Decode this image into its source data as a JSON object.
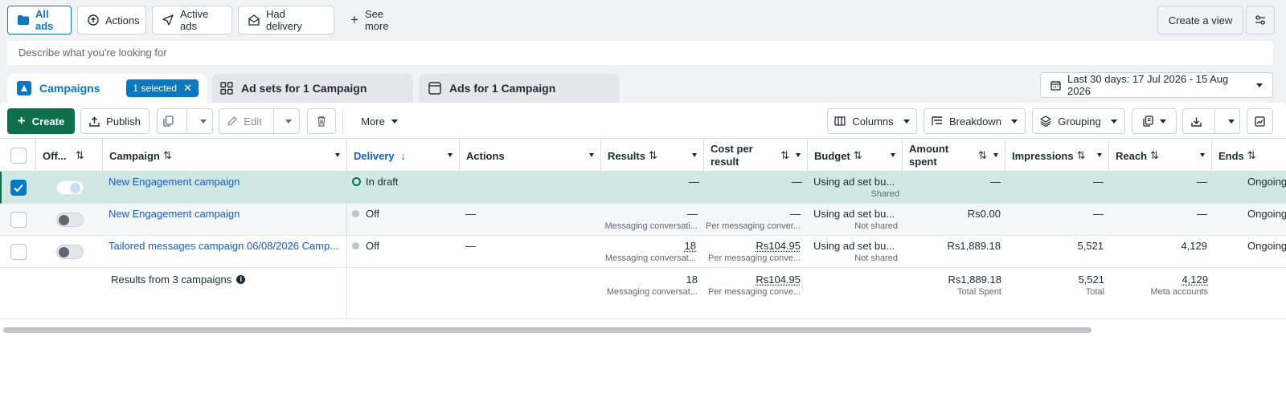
{
  "filters": {
    "all_ads": "All ads",
    "actions": "Actions",
    "active_ads": "Active ads",
    "had_delivery": "Had delivery",
    "see_more": "See more",
    "create_view": "Create a view"
  },
  "search": {
    "placeholder": "Describe what you're looking for"
  },
  "tabs": {
    "campaigns": "Campaigns",
    "selected": "1 selected",
    "ad_sets": "Ad sets for 1 Campaign",
    "ads": "Ads for 1 Campaign"
  },
  "date_range": "Last 30 days: 17 Jul 2026 - 15 Aug 2026",
  "toolbar": {
    "create": "Create",
    "publish": "Publish",
    "edit": "Edit",
    "more": "More",
    "columns": "Columns",
    "breakdown": "Breakdown",
    "grouping": "Grouping"
  },
  "columns": {
    "off_on": "Off...",
    "campaign": "Campaign",
    "delivery": "Delivery",
    "actions": "Actions",
    "results": "Results",
    "cost_per_result_1": "Cost per",
    "cost_per_result_2": "result",
    "budget": "Budget",
    "amount_spent_1": "Amount",
    "amount_spent_2": "spent",
    "impressions": "Impressions",
    "reach": "Reach",
    "ends": "Ends"
  },
  "rows": [
    {
      "campaign": "New Engagement campaign",
      "delivery": "In draft",
      "actions": "",
      "results": "—",
      "results_sub": "",
      "cost": "—",
      "cost_sub": "",
      "budget": "Using ad set bu...",
      "budget_sub": "Shared",
      "spent": "—",
      "impressions": "—",
      "reach": "—",
      "ends": "Ongoing"
    },
    {
      "campaign": "New Engagement campaign",
      "delivery": "Off",
      "actions": "—",
      "results": "—",
      "results_sub": "Messaging conversati...",
      "cost": "—",
      "cost_sub": "Per messaging conver...",
      "budget": "Using ad set bu...",
      "budget_sub": "Not shared",
      "spent": "Rs0.00",
      "impressions": "—",
      "reach": "—",
      "ends": "Ongoing"
    },
    {
      "campaign": "Tailored messages campaign 06/08/2026 Camp...",
      "delivery": "Off",
      "actions": "—",
      "results": "18",
      "results_sub": "Messaging conversat...",
      "cost": "Rs104.95",
      "cost_sub": "Per messaging conve...",
      "budget": "Using ad set bu...",
      "budget_sub": "Not shared",
      "spent": "Rs1,889.18",
      "impressions": "5,521",
      "reach": "4,129",
      "ends": "Ongoing"
    }
  ],
  "summary": {
    "label": "Results from 3 campaigns",
    "results": "18",
    "results_sub": "Messaging conversat...",
    "cost": "Rs104.95",
    "cost_sub": "Per messaging conve...",
    "spent": "Rs1,889.18",
    "spent_sub": "Total Spent",
    "impressions": "5,521",
    "impressions_sub": "Total",
    "reach": "4,129",
    "reach_sub": "Meta accounts"
  },
  "colors": {
    "accent": "#0a78be",
    "primary": "#0e6f4c",
    "selected_row": "#cfe8e3",
    "link": "#1a5bc7"
  }
}
